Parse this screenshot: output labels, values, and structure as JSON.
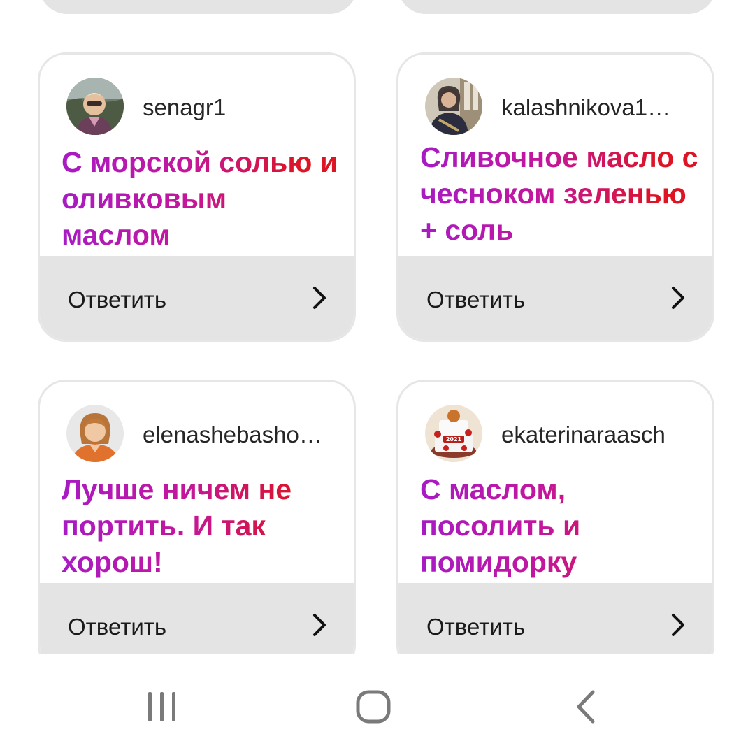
{
  "cards": [
    {
      "username": "senagr1",
      "question": "С морской солью и оливковым маслом",
      "reply_label": "Ответить"
    },
    {
      "username": "kalashnikova1…",
      "question": "Сливочное масло с чесноком зеленью + соль",
      "reply_label": "Ответить"
    },
    {
      "username": "elenashebasho…",
      "question": "Лучше ничем не портить. И так хорош!",
      "reply_label": "Ответить"
    },
    {
      "username": "ekaterinaraasch",
      "question": "С маслом, посолить и помидорку",
      "reply_label": "Ответить"
    }
  ],
  "icons": {
    "reply_arrow": "chevron-right-icon",
    "recent_apps": "recent-apps-icon",
    "home": "home-icon",
    "back": "back-icon"
  },
  "colors": {
    "gradient_start": "#a81bc4",
    "gradient_end": "#dc1424",
    "reply_bar": "#e4e4e4",
    "card_border": "#e6e6e6"
  }
}
